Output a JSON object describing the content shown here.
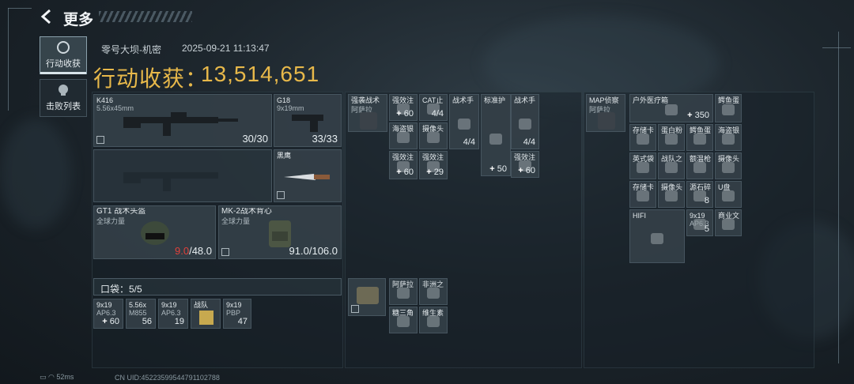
{
  "header": {
    "title": "更多",
    "back_icon": "chevron-left-icon"
  },
  "tabs": [
    {
      "label": "行动收获",
      "icon": "target-icon",
      "active": true
    },
    {
      "label": "击败列表",
      "icon": "skull-icon",
      "active": false
    }
  ],
  "match": {
    "map": "零号大坝-机密",
    "datetime": "2025-09-21 11:13:47"
  },
  "earnings": {
    "label": "行动收获：",
    "value": "13,514,651",
    "color": "#e7b84a"
  },
  "equipment": {
    "primary": {
      "name": "K416",
      "caliber": "5.56x45mm",
      "ammo": "30/30"
    },
    "sidearm": {
      "name": "G18",
      "caliber": "9x19mm",
      "ammo": "33/33"
    },
    "melee": {
      "name": "黑鹰"
    },
    "helmet": {
      "name": "GT1 战术头盔",
      "faction": "全球力量",
      "durability": "9.0",
      "durability_max": "/48.0"
    },
    "armor": {
      "name": "MK-2战术背心",
      "faction": "全球力量",
      "durability": "91.0/106.0"
    }
  },
  "pocket": {
    "label": "口袋：5/5",
    "items": [
      {
        "name": "9x19",
        "sub": "AP6.3",
        "count": "60"
      },
      {
        "name": "5.56x",
        "sub": "M855",
        "count": "56"
      },
      {
        "name": "9x19",
        "sub": "AP6.3",
        "count": "19"
      },
      {
        "name": "战队",
        "sub": "",
        "count": ""
      },
      {
        "name": "9x19",
        "sub": "PBP",
        "count": "47"
      }
    ]
  },
  "rig": {
    "name": "强袭战术",
    "sub": "阿萨拉",
    "items": [
      {
        "name": "强效注",
        "count": "60"
      },
      {
        "name": "CAT止",
        "count": "4/4"
      },
      {
        "name": "战术手",
        "count": "4/4"
      },
      {
        "name": "标准护",
        "count": "50"
      },
      {
        "name": "战术手",
        "count": "4/4"
      },
      {
        "name": "海盗银",
        "count": ""
      },
      {
        "name": "摄像头",
        "count": ""
      },
      {
        "name": "强效注",
        "count": "60"
      },
      {
        "name": "强效注",
        "count": "29"
      },
      {
        "name": "强效注",
        "count": "60"
      }
    ]
  },
  "backpack": {
    "name": "MAP侦察",
    "sub": "阿萨拉",
    "items": [
      {
        "name": "户外医疗箱",
        "count": "350"
      },
      {
        "name": "鳄鱼蛋",
        "count": ""
      },
      {
        "name": "存储卡",
        "count": ""
      },
      {
        "name": "蛋白粉",
        "count": ""
      },
      {
        "name": "鳄鱼蛋",
        "count": ""
      },
      {
        "name": "海盗银",
        "count": ""
      },
      {
        "name": "英式袋",
        "count": ""
      },
      {
        "name": "战队之",
        "count": ""
      },
      {
        "name": "额温枪",
        "count": ""
      },
      {
        "name": "摄像头",
        "count": ""
      },
      {
        "name": "存储卡",
        "count": ""
      },
      {
        "name": "摄像头",
        "count": ""
      },
      {
        "name": "源石碎",
        "count": "8"
      },
      {
        "name": "U盘",
        "count": ""
      },
      {
        "name": "HIFI",
        "count": ""
      },
      {
        "name": "9x19",
        "sub": "AP6.3",
        "count": "5"
      },
      {
        "name": "商业文",
        "count": ""
      }
    ]
  },
  "safebox": {
    "items": [
      {
        "name": "阿萨拉",
        "count": ""
      },
      {
        "name": "非洲之",
        "count": ""
      },
      {
        "name": "糖三角",
        "count": ""
      },
      {
        "name": "维生素",
        "count": ""
      }
    ]
  },
  "status": {
    "battery": "battery-icon",
    "wifi": "wifi-icon",
    "ping": "52ms",
    "uid": "CN UID:4522359954479110278​8"
  }
}
